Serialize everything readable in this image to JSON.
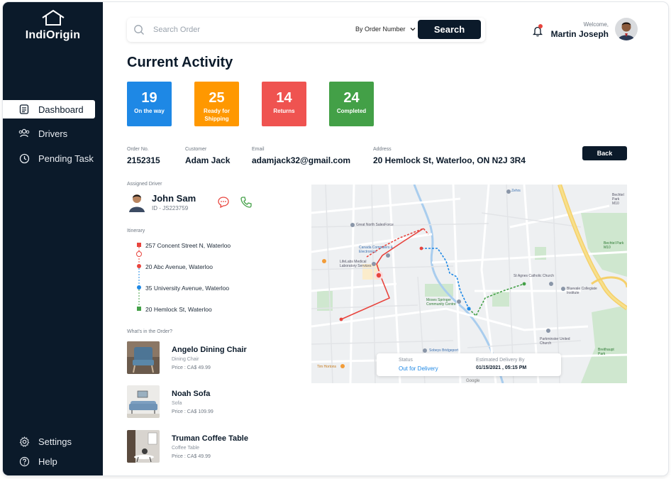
{
  "app": {
    "name": "IndiOrigin"
  },
  "sidebar": {
    "items": [
      {
        "label": "Dashboard",
        "icon": "document-icon",
        "active": true
      },
      {
        "label": "Drivers",
        "icon": "users-icon",
        "active": false
      },
      {
        "label": "Pending Task",
        "icon": "clock-icon",
        "active": false
      }
    ],
    "bottom": [
      {
        "label": "Settings",
        "icon": "gear-icon"
      },
      {
        "label": "Help",
        "icon": "help-icon"
      }
    ]
  },
  "search": {
    "placeholder": "Search Order",
    "filter": "By Order Number",
    "button": "Search"
  },
  "user": {
    "welcome": "Welcome,",
    "name": "Martin Joseph"
  },
  "page": {
    "title": "Current Activity"
  },
  "stats": [
    {
      "value": "19",
      "label": "On the way",
      "color": "#1e88e5"
    },
    {
      "value": "25",
      "label": "Ready for Shipping",
      "color": "#ff9800"
    },
    {
      "value": "14",
      "label": "Returns",
      "color": "#ef5350"
    },
    {
      "value": "24",
      "label": "Completed",
      "color": "#43a047"
    }
  ],
  "order": {
    "order_no_label": "Order No.",
    "order_no": "2152315",
    "customer_label": "Customer",
    "customer": "Adam Jack",
    "email_label": "Email",
    "email": "adamjack32@gmail.com",
    "address_label": "Address",
    "address": "20 Hemlock St, Waterloo, ON N2J 3R4",
    "back": "Back"
  },
  "driver": {
    "section_label": "Assigned Driver",
    "name": "John Sam",
    "id": "ID - JS223759"
  },
  "itinerary": {
    "section_label": "Itinerary",
    "stops": [
      "257 Concent Street N, Waterloo",
      "20 Abc Avenue, Waterloo",
      "35 University Avenue, Waterloo",
      "20 Hemlock St, Waterloo"
    ]
  },
  "order_items": {
    "section_label": "What's in the Order?",
    "items": [
      {
        "name": "Angelo Dining Chair",
        "category": "Dining Chair",
        "price": "Price : CA$ 49.99"
      },
      {
        "name": "Noah Sofa",
        "category": "Sofa",
        "price": "Price : CA$ 109.99"
      },
      {
        "name": "Truman Coffee Table",
        "category": "Coffee Table",
        "price": "Price : CA$ 49.99"
      }
    ]
  },
  "map": {
    "labels": {
      "zehrs": "Zehrs",
      "sales": "Great North SalesForce",
      "canada": "Canada Computers & Electronics",
      "lifelabs": "LifeLabs Medical Laboratory Services",
      "stagnes": "St Agnes Catholic Church",
      "bluevale": "Bluevale Collegiate Institute",
      "moses": "Moses Springer Community Centre",
      "parkminster": "Parkminster United Church",
      "sobeys": "Sobeys Bridgeport",
      "timhortons": "Tim Hortons",
      "bechtel": "Bechtel Park M10",
      "breithaupt": "Breithaupt Park",
      "google": "Google"
    },
    "status": {
      "status_label": "Status",
      "status_value": "Out for Delivery",
      "eta_label": "Estimated Delivery By",
      "eta_value": "01/15/2021 , 05:15 PM"
    }
  }
}
